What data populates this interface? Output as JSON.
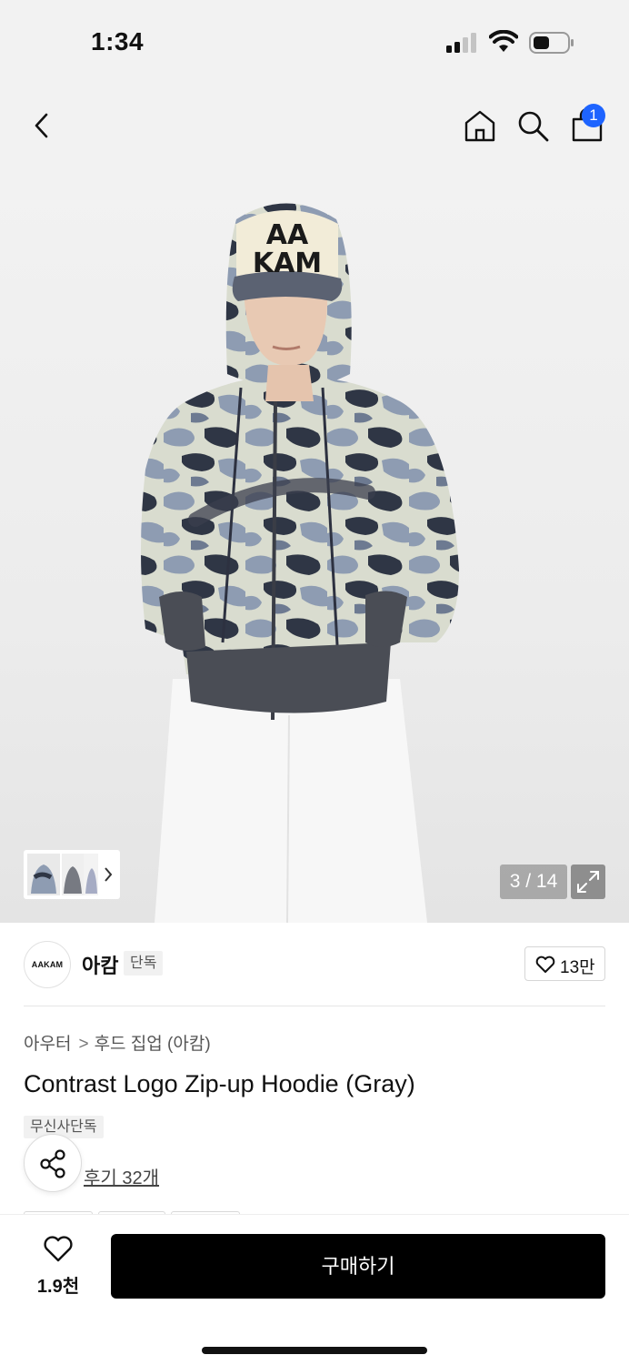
{
  "status_bar": {
    "time": "1:34"
  },
  "nav": {
    "cart_badge": "1"
  },
  "gallery": {
    "counter": "3 / 14",
    "hat_text_line1": "AA",
    "hat_text_line2": "KAM",
    "colors": {
      "camo_light": "#d9dccf",
      "camo_mid": "#8e9cb2",
      "camo_dark": "#2f3645",
      "rib": "#4a4d55",
      "pants": "#f7f7f7"
    }
  },
  "brand": {
    "logo_text": "AAKAM",
    "name": "아캄",
    "badge": "단독",
    "like_count": "13만"
  },
  "breadcrumb": {
    "category": "아우터",
    "separator": ">",
    "subcategory": "후드 집업 (아캄)"
  },
  "product": {
    "title": "Contrast Logo Zip-up Hoodie (Gray)",
    "tag": "무신사단독",
    "reviews": "후기 32개"
  },
  "bottom_bar": {
    "wish_count": "1.9천",
    "buy_label": "구매하기"
  },
  "accent_color": "#1e64ff"
}
